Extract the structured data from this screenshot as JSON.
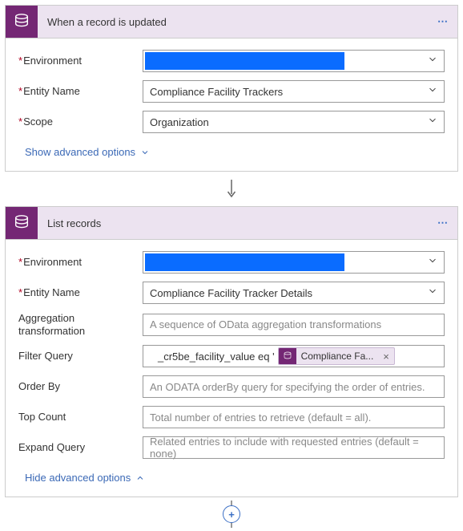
{
  "card1": {
    "title": "When a record is updated",
    "menu": "⋯",
    "labels": {
      "env": "Environment",
      "entity": "Entity Name",
      "scope": "Scope"
    },
    "values": {
      "env": "",
      "entity": "Compliance Facility Trackers",
      "scope": "Organization"
    },
    "advToggle": "Show advanced options"
  },
  "card2": {
    "title": "List records",
    "menu": "⋯",
    "labels": {
      "env": "Environment",
      "entity": "Entity Name",
      "agg": "Aggregation transformation",
      "filter": "Filter Query",
      "order": "Order By",
      "top": "Top Count",
      "expand": "Expand Query"
    },
    "values": {
      "env": "",
      "entity": "Compliance Facility Tracker Details",
      "filter_prefix": "_cr5be_facility_value eq '",
      "filter_token": "Compliance Fa...",
      "token_x": "×"
    },
    "placeholders": {
      "agg": "A sequence of OData aggregation transformations",
      "order": "An ODATA orderBy query for specifying the order of entries.",
      "top": "Total number of entries to retrieve (default = all).",
      "expand": "Related entries to include with requested entries (default = none)"
    },
    "advToggle": "Hide advanced options"
  },
  "add": "+"
}
